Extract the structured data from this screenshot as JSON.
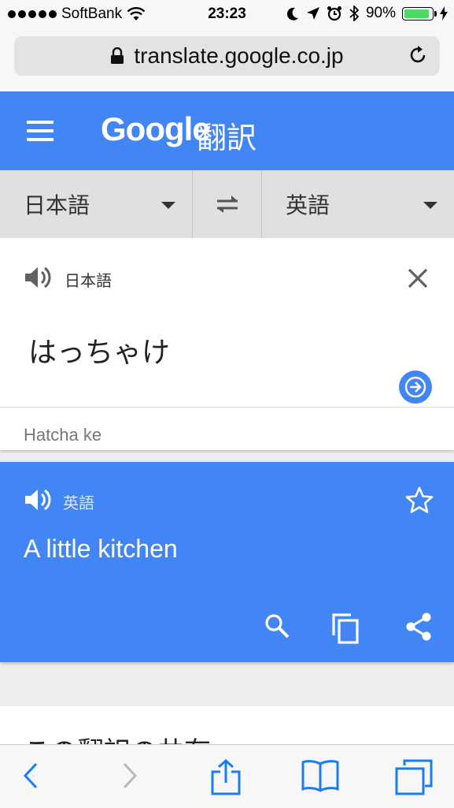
{
  "status": {
    "carrier": "SoftBank",
    "time": "23:23",
    "battery": "90%",
    "battery_level": 0.9
  },
  "browser": {
    "url": "translate.google.co.jp"
  },
  "header": {
    "brand": "Google",
    "product": "翻訳"
  },
  "languages": {
    "source": "日本語",
    "target": "英語"
  },
  "source_card": {
    "language": "日本語",
    "text": "はっちゃけ",
    "transliteration": "Hatcha ke"
  },
  "result_card": {
    "language": "英語",
    "text": "A little kitchen"
  },
  "share_section": {
    "title": "この翻訳の共有"
  },
  "colors": {
    "accent": "#4285f4"
  }
}
